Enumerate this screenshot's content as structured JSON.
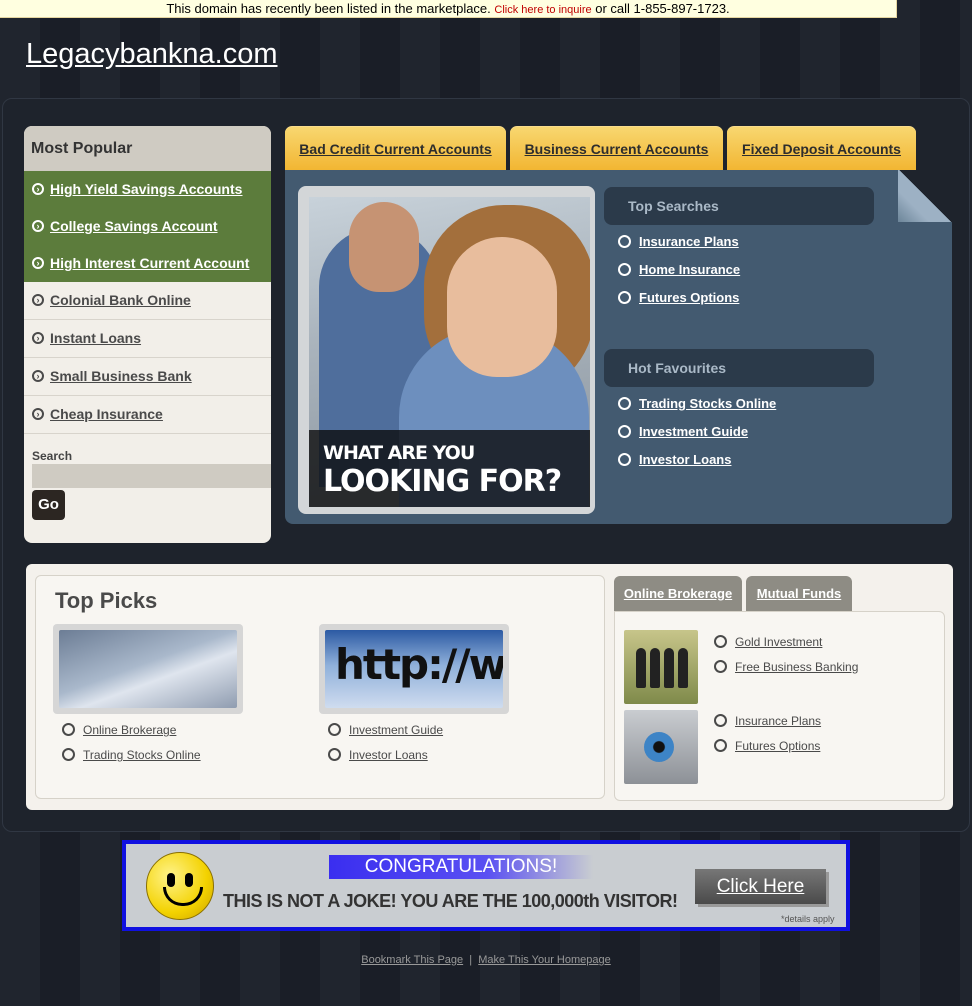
{
  "topbar": {
    "text_before": "This domain has recently been listed in the marketplace.",
    "inquire_link": "Click here to inquire",
    "text_after": " or call 1-855-897-1723."
  },
  "site_title": "Legacybankna.com",
  "sidebar": {
    "heading": "Most Popular",
    "items": [
      {
        "label": "High Yield Savings Accounts",
        "highlight": true
      },
      {
        "label": "College Savings Account",
        "highlight": true
      },
      {
        "label": "High Interest Current Account",
        "highlight": true
      },
      {
        "label": "Colonial Bank Online",
        "highlight": false
      },
      {
        "label": "Instant Loans",
        "highlight": false
      },
      {
        "label": "Small Business Bank",
        "highlight": false
      },
      {
        "label": "Cheap Insurance",
        "highlight": false
      }
    ],
    "search_label": "Search",
    "search_value": "",
    "go_label": "Go"
  },
  "tabs": [
    {
      "label": "Bad Credit Current Accounts"
    },
    {
      "label": "Business Current Accounts"
    },
    {
      "label": "Fixed Deposit Accounts"
    }
  ],
  "feature": {
    "caption_line1": "WHAT ARE YOU",
    "caption_line2": "LOOKING FOR?",
    "top_searches": {
      "heading": "Top Searches",
      "links": [
        "Insurance Plans",
        "Home Insurance",
        "Futures Options"
      ]
    },
    "hot_favourites": {
      "heading": "Hot Favourites",
      "links": [
        "Trading Stocks Online",
        "Investment Guide",
        "Investor Loans"
      ]
    }
  },
  "top_picks": {
    "title": "Top Picks",
    "columns": [
      {
        "image": "laptop-image",
        "links": [
          "Online Brokerage",
          "Trading Stocks Online"
        ]
      },
      {
        "image": "http-image",
        "image_text": "http://www",
        "links": [
          "Investment Guide",
          "Investor Loans"
        ]
      }
    ]
  },
  "right_tabs": [
    {
      "label": "Online Brokerage",
      "active": true
    },
    {
      "label": "Mutual Funds",
      "active": false
    }
  ],
  "online_brokerage": {
    "groups": [
      {
        "image": "people-image",
        "links": [
          "Gold Investment",
          "Free Business Banking"
        ]
      },
      {
        "image": "eye-image",
        "links": [
          "Insurance Plans",
          "Futures Options"
        ]
      }
    ]
  },
  "banner": {
    "congrats": "CONGRATULATIONS!",
    "message": "THIS IS NOT A JOKE! YOU ARE THE 100,000th VISITOR!",
    "button": "Click Here",
    "details": "*details apply"
  },
  "footer": {
    "bookmark": "Bookmark This Page",
    "separator": "|",
    "homepage": "Make This Your Homepage"
  },
  "colors": {
    "sidebar_green": "#5c7c3c",
    "tab_yellow": "#f6c245",
    "feature_blue": "#435a70",
    "banner_border": "#1010e0"
  }
}
